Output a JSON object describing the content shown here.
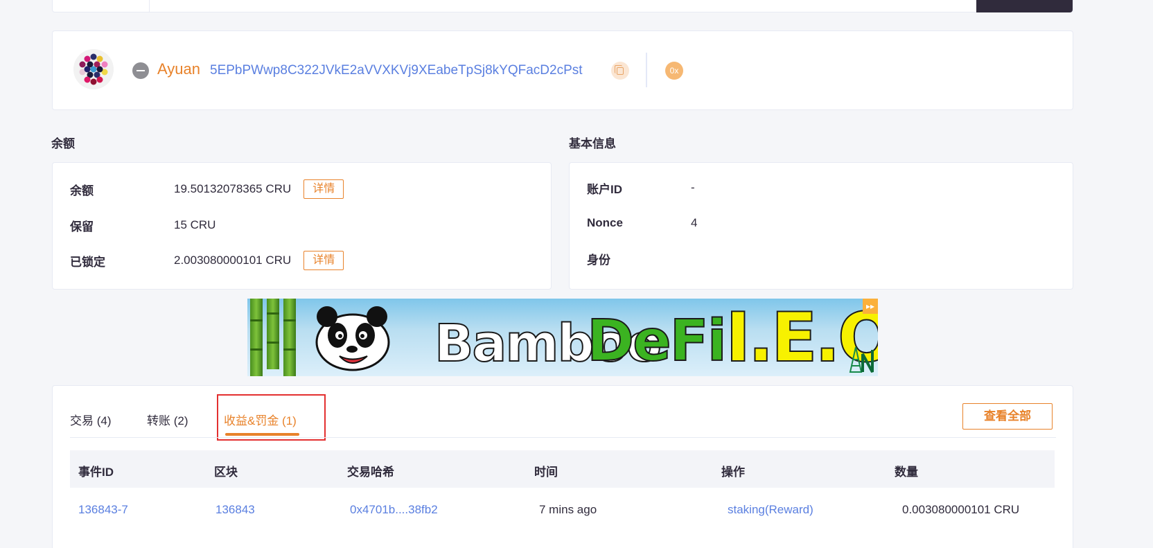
{
  "account": {
    "name": "Ayuan",
    "address": "5EPbPWwp8C322JVkE2aVVXKVj9XEabeTpSj8kYQFacD2cPst",
    "hex_label": "0x"
  },
  "balance_section": {
    "title": "余额",
    "rows": [
      {
        "label": "余额",
        "value": "19.50132078365 CRU",
        "detail": "详情"
      },
      {
        "label": "保留",
        "value": "15 CRU"
      },
      {
        "label": "已锁定",
        "value": "2.003080000101 CRU",
        "detail": "详情"
      }
    ]
  },
  "basic_info_section": {
    "title": "基本信息",
    "rows": [
      {
        "label": "账户ID",
        "value": "-"
      },
      {
        "label": "Nonce",
        "value": "4"
      },
      {
        "label": "身份",
        "value": ""
      }
    ]
  },
  "banner": {
    "text_1": "Bamboo",
    "text_2": "DeFi",
    "text_3": "I.E.O",
    "close_label": "▸▸"
  },
  "tabs": [
    {
      "label": "交易 (4)",
      "active": false
    },
    {
      "label": "转账 (2)",
      "active": false
    },
    {
      "label": "收益&罚金 (1)",
      "active": true
    }
  ],
  "view_all_label": "查看全部",
  "table": {
    "columns": [
      "事件ID",
      "区块",
      "交易哈希",
      "时间",
      "操作",
      "数量"
    ],
    "rows": [
      [
        "136843-7",
        "136843",
        "0x4701b....38fb2",
        "7 mins ago",
        "staking(Reward)",
        "0.003080000101 CRU"
      ]
    ]
  },
  "colors": {
    "accent": "#e8822a",
    "link": "#5a7fe0",
    "text": "#302b3c",
    "highlight": "#e32f2f"
  }
}
